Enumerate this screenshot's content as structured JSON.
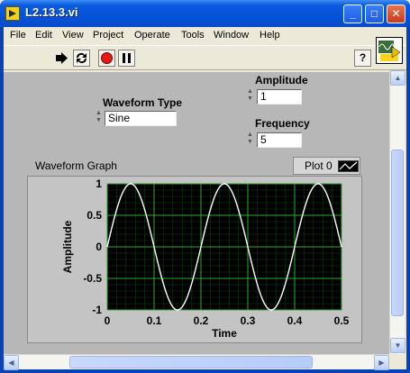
{
  "window": {
    "title": "L2.13.3.vi",
    "controls": {
      "minimize": "_",
      "maximize": "□",
      "close": "✕"
    }
  },
  "menu": [
    "File",
    "Edit",
    "View",
    "Project",
    "Operate",
    "Tools",
    "Window",
    "Help"
  ],
  "toolbar": {
    "run_icon": "run-arrow-icon",
    "run_continuous_icon": "run-continuously-icon",
    "abort_icon": "abort-stop-icon",
    "pause_icon": "pause-icon",
    "help_label": "?"
  },
  "controls": {
    "waveform_type": {
      "label": "Waveform Type",
      "value": "Sine"
    },
    "amplitude": {
      "label": "Amplitude",
      "value": "1"
    },
    "frequency": {
      "label": "Frequency",
      "value": "5"
    }
  },
  "graph": {
    "label": "Waveform Graph",
    "legend_name": "Plot 0",
    "xlabel": "Time",
    "ylabel": "Amplitude"
  },
  "chart_data": {
    "type": "line",
    "xlim": [
      0,
      0.5
    ],
    "ylim": [
      -1,
      1
    ],
    "x_ticks": [
      "0",
      "0.1",
      "0.2",
      "0.3",
      "0.4",
      "0.5"
    ],
    "y_ticks": [
      "1",
      "0.5",
      "0",
      "-0.5",
      "-1"
    ],
    "grid": true,
    "series": [
      {
        "function": "sine",
        "amplitude": 1,
        "frequency_hz": 5,
        "color": "#ffffff"
      }
    ],
    "plot_background": "#000000",
    "grid_color": "#1f7a1f"
  }
}
